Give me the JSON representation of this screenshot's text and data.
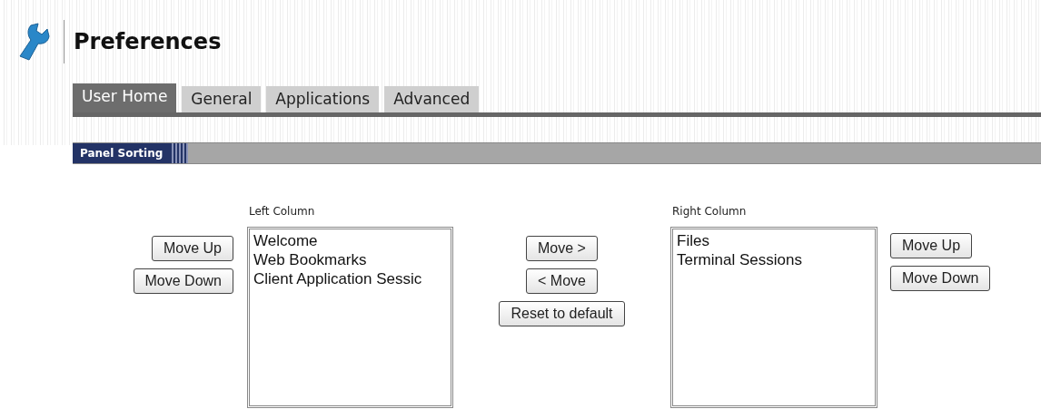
{
  "header": {
    "title": "Preferences"
  },
  "tabs": [
    {
      "label": "User Home",
      "selected": true
    },
    {
      "label": "General",
      "selected": false
    },
    {
      "label": "Applications",
      "selected": false
    },
    {
      "label": "Advanced",
      "selected": false
    }
  ],
  "section": {
    "title": "Panel Sorting"
  },
  "left_column": {
    "label": "Left Column",
    "buttons": [
      "Move Up",
      "Move Down"
    ],
    "items": [
      "Welcome",
      "Web Bookmarks",
      "Client Application Sessic"
    ]
  },
  "middle_buttons": [
    "Move >",
    "< Move",
    "Reset to default"
  ],
  "right_column": {
    "label": "Right Column",
    "buttons": [
      "Move Up",
      "Move Down"
    ],
    "items": [
      "Files",
      "Terminal Sessions"
    ]
  }
}
